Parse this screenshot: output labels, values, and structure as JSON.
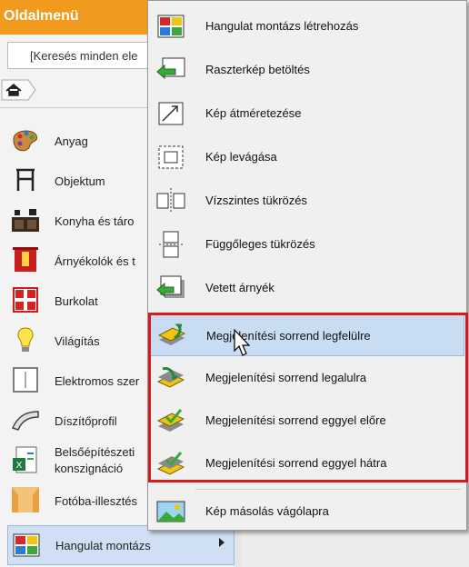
{
  "panel": {
    "title": "Oldalmenü",
    "search_text": "[Keresés minden ele",
    "items": [
      {
        "label": "Anyag",
        "icon": "palette-icon"
      },
      {
        "label": "Objektum",
        "icon": "chair-icon"
      },
      {
        "label": "Konyha és táro",
        "icon": "kitchen-icon"
      },
      {
        "label": "Árnyékolók és t",
        "icon": "curtain-icon"
      },
      {
        "label": "Burkolat",
        "icon": "tiles-icon"
      },
      {
        "label": "Világítás",
        "icon": "bulb-icon"
      },
      {
        "label": "Elektromos szer",
        "icon": "switch-icon"
      },
      {
        "label": "Díszítőprofil",
        "icon": "molding-icon"
      },
      {
        "label": "Belsőépítészeti",
        "label2": "konszignáció",
        "icon": "excel-icon"
      },
      {
        "label": "Fotóba-illesztés",
        "icon": "photo-match-icon"
      },
      {
        "label": "Hangulat montázs",
        "icon": "mood-montage-icon"
      }
    ]
  },
  "menu": {
    "items": [
      {
        "label": "Hangulat montázs létrehozás",
        "icon": "mood-montage-icon"
      },
      {
        "label": "Raszterkép betöltés",
        "icon": "raster-load-icon"
      },
      {
        "label": "Kép átméretezése",
        "icon": "image-resize-icon"
      },
      {
        "label": "Kép levágása",
        "icon": "image-crop-icon"
      },
      {
        "label": "Vízszintes tükrözés",
        "icon": "flip-horizontal-icon"
      },
      {
        "label": "Függőleges tükrözés",
        "icon": "flip-vertical-icon"
      },
      {
        "label": "Vetett árnyék",
        "icon": "drop-shadow-icon"
      },
      {
        "label": "Megjelenítési sorrend legfelülre",
        "icon": "bring-to-front-icon"
      },
      {
        "label": "Megjelenítési sorrend legalulra",
        "icon": "send-to-back-icon"
      },
      {
        "label": "Megjelenítési sorrend eggyel előre",
        "icon": "bring-forward-icon"
      },
      {
        "label": "Megjelenítési sorrend eggyel hátra",
        "icon": "send-backward-icon"
      },
      {
        "label": "Kép másolás vágólapra",
        "icon": "copy-image-icon"
      }
    ]
  },
  "colors": {
    "header": "#f19a1e",
    "highlight_border": "#d71a20",
    "selection": "#c8dcf2"
  }
}
